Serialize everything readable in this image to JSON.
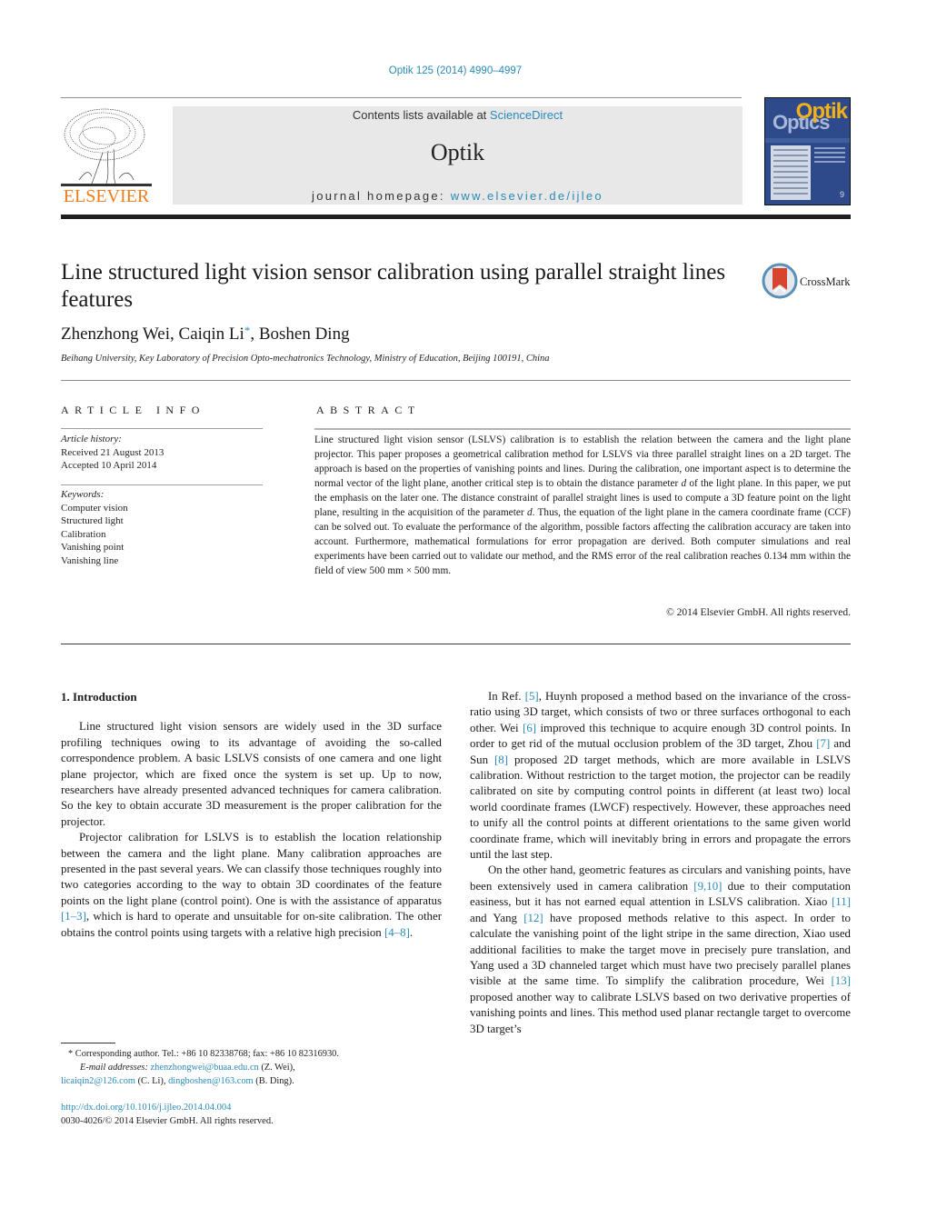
{
  "journal": {
    "citation": "Optik 125 (2014) 4990–4997",
    "contents_prefix": "Contents lists available at ",
    "contents_link": "ScienceDirect",
    "name": "Optik",
    "homepage_prefix": "journal homepage: ",
    "homepage_link": "www.elsevier.de/ijleo",
    "publisher_logo_text": "ELSEVIER",
    "cover": {
      "title_top": "Optik",
      "title_bottom": "Optics",
      "issue": "9"
    }
  },
  "article": {
    "title": "Line structured light vision sensor calibration using parallel straight lines features",
    "crossmark_label": "CrossMark",
    "authors": [
      {
        "name": "Zhenzhong Wei",
        "sep": ", "
      },
      {
        "name": "Caiqin Li",
        "mark": "*",
        "sep": ", "
      },
      {
        "name": "Boshen Ding",
        "sep": ""
      }
    ],
    "affiliation": "Beihang University, Key Laboratory of Precision Opto-mechatronics Technology, Ministry of Education, Beijing 100191, China"
  },
  "article_info": {
    "heading": "ARTICLE INFO",
    "history_label": "Article history:",
    "received": "Received 21 August 2013",
    "accepted": "Accepted 10 April 2014",
    "keywords_label": "Keywords:",
    "keywords": [
      "Computer vision",
      "Structured light",
      "Calibration",
      "Vanishing point",
      "Vanishing line"
    ]
  },
  "abstract": {
    "heading": "ABSTRACT",
    "parts": [
      {
        "t": "Line structured light vision sensor (LSLVS) calibration is to establish the relation between the camera and the light plane projector. This paper proposes a geometrical calibration method for LSLVS via three parallel straight lines on a 2D target. The approach is based on the properties of vanishing points and lines. During the calibration, one important aspect is to determine the normal vector of the light plane, another critical step is to obtain the distance parameter "
      },
      {
        "t": "d",
        "i": true
      },
      {
        "t": " of the light plane. In this paper, we put the emphasis on the later one. The distance constraint of parallel straight lines is used to compute a 3D feature point on the light plane, resulting in the acquisition of the parameter "
      },
      {
        "t": "d",
        "i": true
      },
      {
        "t": ". Thus, the equation of the light plane in the camera coordinate frame (CCF) can be solved out. To evaluate the performance of the algorithm, possible factors affecting the calibration accuracy are taken into account. Furthermore, mathematical formulations for error propagation are derived. Both computer simulations and real experiments have been carried out to validate our method, and the RMS error of the real calibration reaches 0.134 mm within the field of view 500 mm × 500 mm."
      }
    ],
    "copyright": "© 2014 Elsevier GmbH. All rights reserved."
  },
  "body": {
    "section_heading": "1.  Introduction",
    "left_paragraphs": [
      [
        {
          "t": "Line structured light vision sensors are widely used in the 3D surface profiling techniques owing to its advantage of avoiding the so-called correspondence problem. A basic LSLVS consists of one camera and one light plane projector, which are fixed once the system is set up. Up to now, researchers have already presented advanced techniques for camera calibration. So the key to obtain accurate 3D measurement is the proper calibration for the projector."
        }
      ],
      [
        {
          "t": "Projector calibration for LSLVS is to establish the location relationship between the camera and the light plane. Many calibration approaches are presented in the past several years. We can classify those techniques roughly into two categories according to the way to obtain 3D coordinates of the feature points on the light plane (control point). One is with the assistance of apparatus "
        },
        {
          "t": "[1–3]",
          "ref": true
        },
        {
          "t": ", which is hard to operate and unsuitable for on-site calibration. The other obtains the control points using targets with a relative high precision "
        },
        {
          "t": "[4–8]",
          "ref": true
        },
        {
          "t": "."
        }
      ]
    ],
    "right_paragraphs": [
      [
        {
          "t": "In Ref. "
        },
        {
          "t": "[5]",
          "ref": true
        },
        {
          "t": ", Huynh proposed a method based on the invariance of the cross-ratio using 3D target, which consists of two or three surfaces orthogonal to each other. Wei "
        },
        {
          "t": "[6]",
          "ref": true
        },
        {
          "t": " improved this technique to acquire enough 3D control points. In order to get rid of the mutual occlusion problem of the 3D target, Zhou "
        },
        {
          "t": "[7]",
          "ref": true
        },
        {
          "t": " and Sun "
        },
        {
          "t": "[8]",
          "ref": true
        },
        {
          "t": " proposed 2D target methods, which are more available in LSLVS calibration. Without restriction to the target motion, the projector can be readily calibrated on site by computing control points in different (at least two) local world coordinate frames (LWCF) respectively. However, these approaches need to unify all the control points at different orientations to the same given world coordinate frame, which will inevitably bring in errors and propagate the errors until the last step."
        }
      ],
      [
        {
          "t": "On the other hand, geometric features as circulars and vanishing points, have been extensively used in camera calibration "
        },
        {
          "t": "[9,10]",
          "ref": true
        },
        {
          "t": " due to their computation easiness, but it has not earned equal attention in LSLVS calibration. Xiao "
        },
        {
          "t": "[11]",
          "ref": true
        },
        {
          "t": " and Yang "
        },
        {
          "t": "[12]",
          "ref": true
        },
        {
          "t": " have proposed methods relative to this aspect. In order to calculate the vanishing point of the light stripe in the same direction, Xiao used additional facilities to make the target move in precisely pure translation, and Yang used a 3D channeled target which must have two precisely parallel planes visible at the same time. To simplify the calibration procedure, Wei "
        },
        {
          "t": "[13]",
          "ref": true
        },
        {
          "t": " proposed another way to calibrate LSLVS based on two derivative properties of vanishing points and lines. This method used planar rectangle target to overcome 3D target’s"
        }
      ]
    ]
  },
  "footnote": {
    "corresponding": "* Corresponding author. Tel.: +86 10 82338768; fax: +86 10 82316930.",
    "email_label": "E-mail addresses: ",
    "emails": [
      {
        "address": "zhenzhongwei@buaa.edu.cn",
        "who": " (Z. Wei),"
      },
      {
        "address": "licaiqin2@126.com",
        "who": " (C. Li), "
      },
      {
        "address": "dingboshen@163.com",
        "who": " (B. Ding)."
      }
    ],
    "doi": "http://dx.doi.org/10.1016/j.ijleo.2014.04.004",
    "issn_copyright": "0030-4026/© 2014 Elsevier GmbH. All rights reserved."
  }
}
